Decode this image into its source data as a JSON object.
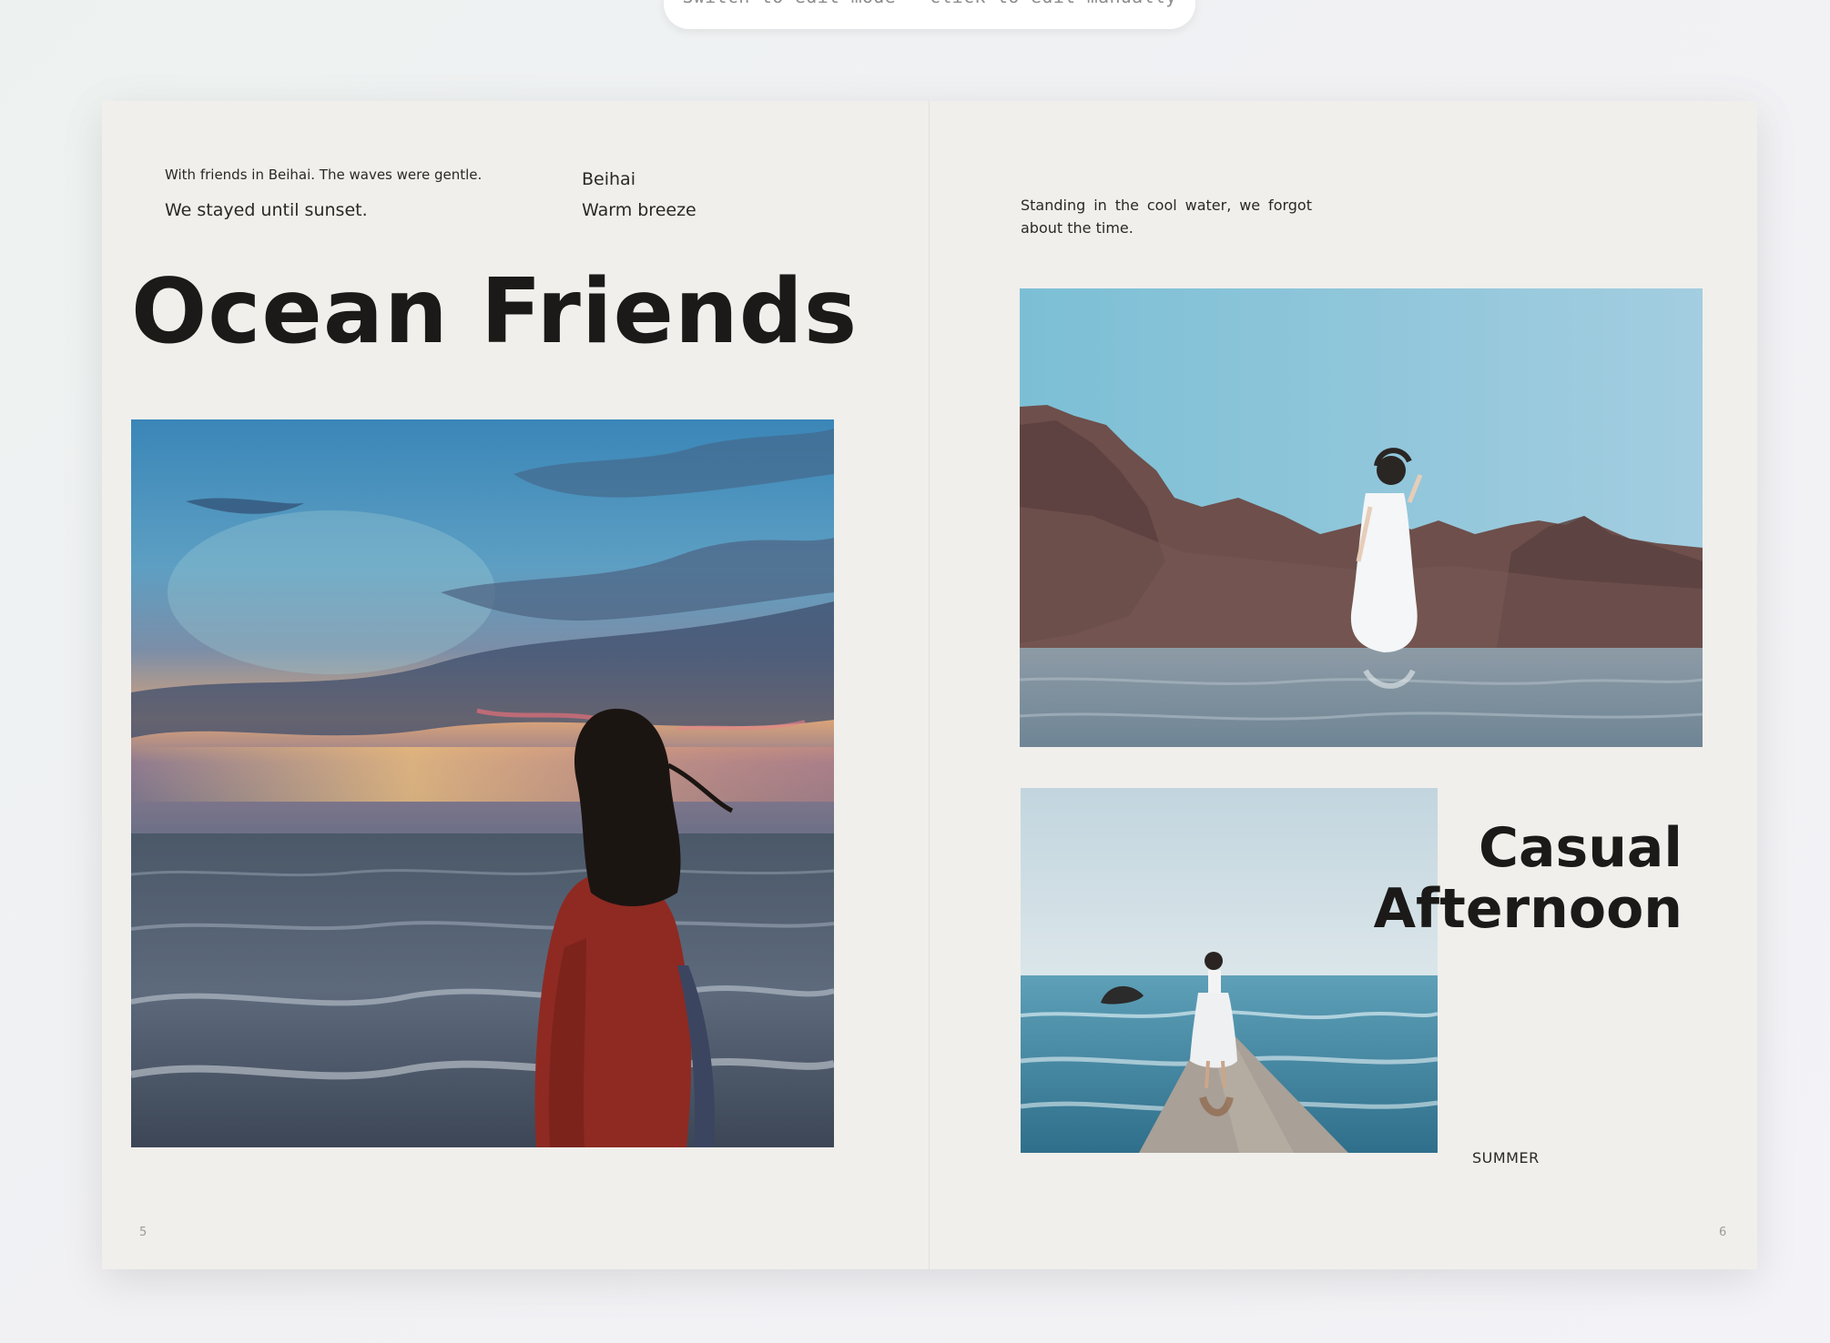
{
  "hint_bar": {
    "text": "Switch to edit mode · click to edit manually"
  },
  "left_page": {
    "caption_small": "With friends in Beihai. The waves were gentle.",
    "caption_main": "We stayed until sunset.",
    "tags": [
      "Beihai",
      "Warm breeze"
    ],
    "headline": "Ocean Friends",
    "photo_icon": "sunset-beach-photo",
    "page_number": "5"
  },
  "right_page": {
    "description": "Standing in the cool water, we forgot about the time.",
    "photo_top_icon": "rocky-shore-photo",
    "photo_bottom_icon": "pier-photo",
    "headline_lines": [
      "Casual",
      "Afternoon"
    ],
    "label": "SUMMER",
    "page_number": "6"
  }
}
